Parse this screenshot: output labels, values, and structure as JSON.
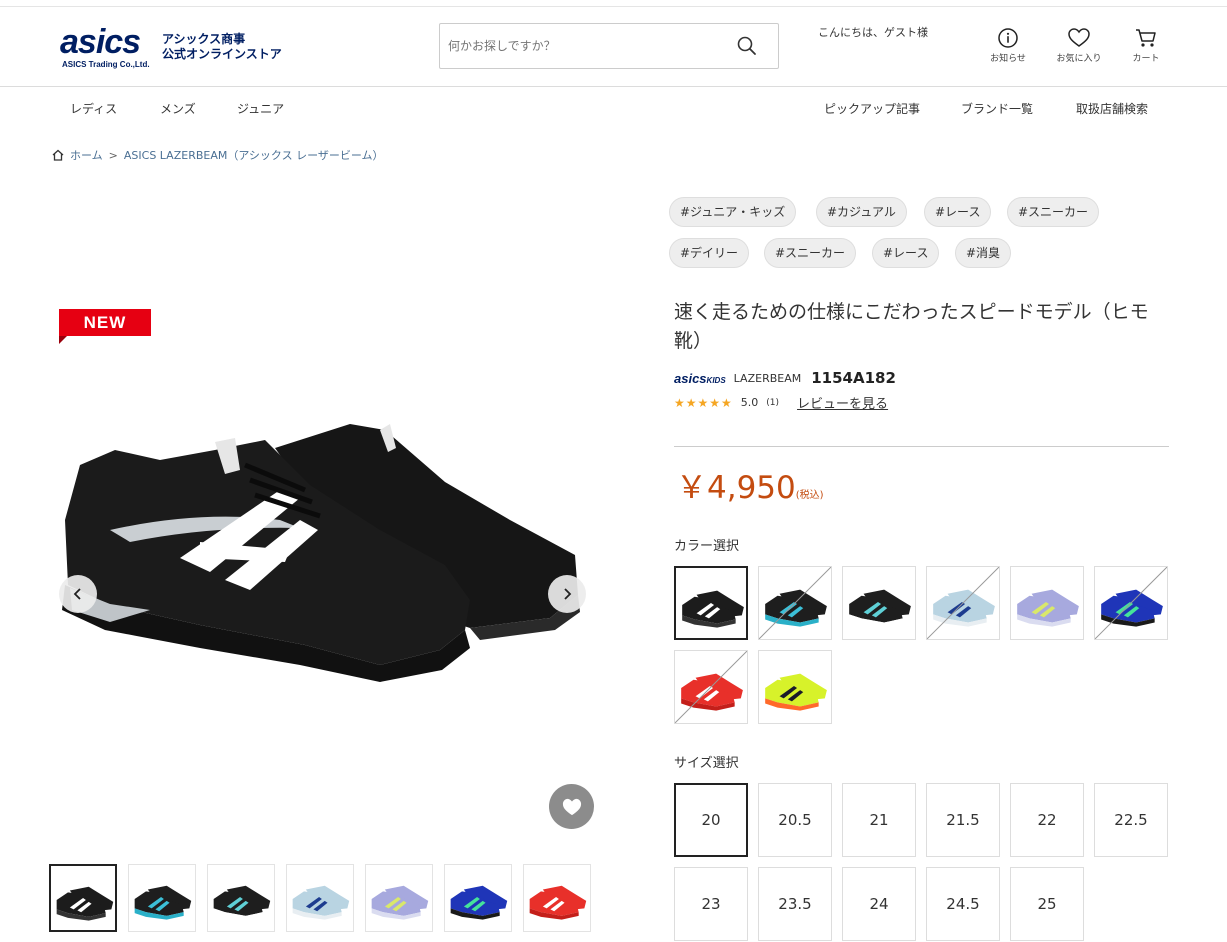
{
  "header": {
    "logo_word": "asics",
    "logo_sub": "ASICS Trading Co.,Ltd.",
    "store_line1": "アシックス商事",
    "store_line2": "公式オンラインストア",
    "search_placeholder": "何かお探しですか？",
    "greeting": "こんにちは、ゲスト様",
    "icons": {
      "news": "お知らせ",
      "favorites": "お気に入り",
      "cart": "カート"
    }
  },
  "nav": {
    "left": [
      "レディス",
      "メンズ",
      "ジュニア"
    ],
    "right": [
      "ピックアップ記事",
      "ブランド一覧",
      "取扱店舗検索"
    ]
  },
  "breadcrumb": {
    "home": "ホーム",
    "sep": ">",
    "current": "ASICS LAZERBEAM（アシックス レーザービーム）"
  },
  "badge": "NEW",
  "tags": [
    [
      "#ジュニア・キッズ",
      "#カジュアル",
      "#レース",
      "#スニーカー"
    ],
    [
      "#デイリー",
      "#スニーカー",
      "#レース",
      "#消臭"
    ]
  ],
  "product": {
    "title": "速く走るための仕様にこだわったスピードモデル（ヒモ靴）",
    "brand_logo": "asics",
    "brand_logo_sub": "KIDS",
    "series": "LAZERBEAM",
    "code": "1154A182",
    "stars": "★★★★★",
    "rating": "5.0",
    "review_count": "(1)",
    "review_link": "レビューを見る",
    "price": "￥4,950",
    "tax_note": "(税込)"
  },
  "color_section": {
    "title": "カラー選択",
    "swatches": [
      {
        "upper": "#1c1c1c",
        "accent": "#ffffff",
        "sole": "#333333",
        "soldout": false,
        "selected": true
      },
      {
        "upper": "#1e1e1e",
        "accent": "#3cc0d8",
        "sole": "#2ab0c8",
        "soldout": true,
        "selected": false
      },
      {
        "upper": "#1e1e1e",
        "accent": "#5fd0d6",
        "sole": "#ffffff",
        "soldout": false,
        "selected": false
      },
      {
        "upper": "#b9d4e2",
        "accent": "#1d3c8f",
        "sole": "#e8eef2",
        "soldout": true,
        "selected": false
      },
      {
        "upper": "#a7a9de",
        "accent": "#d9e86a",
        "sole": "#dadcf0",
        "soldout": false,
        "selected": false
      },
      {
        "upper": "#1f35b8",
        "accent": "#45e39a",
        "sole": "#1a1a1a",
        "soldout": true,
        "selected": false
      },
      {
        "upper": "#e8302a",
        "accent": "#ffffff",
        "sole": "#c41f1a",
        "soldout": true,
        "selected": false
      },
      {
        "upper": "#d7f22a",
        "accent": "#1a1a2a",
        "sole": "#ff6a2a",
        "soldout": false,
        "selected": false
      }
    ]
  },
  "size_section": {
    "title": "サイズ選択",
    "sizes": [
      "20",
      "20.5",
      "21",
      "21.5",
      "22",
      "22.5",
      "23",
      "23.5",
      "24",
      "24.5",
      "25"
    ],
    "selected": "20"
  },
  "thumbnails": [
    {
      "upper": "#1c1c1c",
      "accent": "#ffffff",
      "sole": "#333333"
    },
    {
      "upper": "#1e1e1e",
      "accent": "#3cc0d8",
      "sole": "#2ab0c8"
    },
    {
      "upper": "#1e1e1e",
      "accent": "#5fd0d6",
      "sole": "#ffffff"
    },
    {
      "upper": "#b9d4e2",
      "accent": "#1d3c8f",
      "sole": "#e8eef2"
    },
    {
      "upper": "#a7a9de",
      "accent": "#d9e86a",
      "sole": "#dadcf0"
    },
    {
      "upper": "#1f35b8",
      "accent": "#45e39a",
      "sole": "#1a1a1a"
    },
    {
      "upper": "#e8302a",
      "accent": "#ffffff",
      "sole": "#c41f1a"
    }
  ],
  "colors": {
    "brand": "#001e62",
    "price": "#c44c10",
    "new_badge": "#e60012",
    "link": "#4a6f93",
    "star": "#f5a623"
  }
}
